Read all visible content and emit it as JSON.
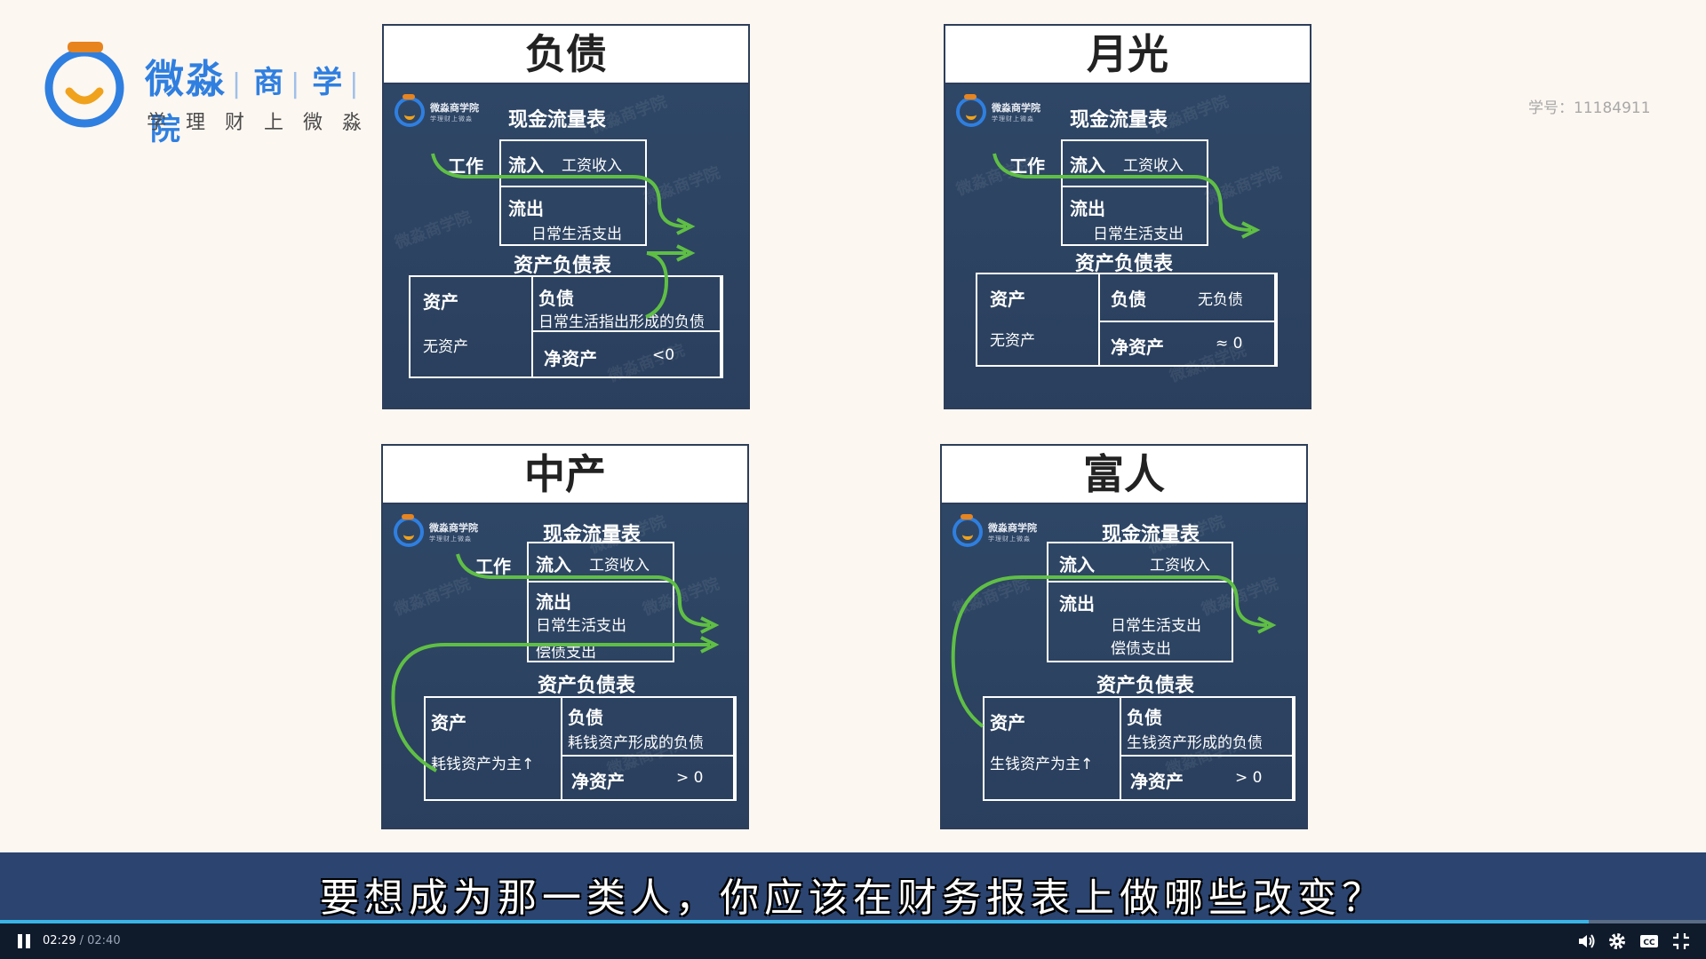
{
  "brand": {
    "name": "微淼",
    "sub": "商",
    "sub2": "学",
    "sub3": "院",
    "slogan": "学理财上微淼"
  },
  "student_id": "学号：11184911",
  "cards": {
    "debt": {
      "title": "负债",
      "cashflow_title": "现金流量表",
      "work": "工作",
      "inflow": "流入",
      "inflow_value": "工资收入",
      "outflow": "流出",
      "outflow_value": "日常生活支出",
      "balance_title": "资产负债表",
      "assets": "资产",
      "assets_value": "无资产",
      "liabilities": "负债",
      "liabilities_value": "日常生活指出形成的负债",
      "net": "净资产",
      "net_value": "<0"
    },
    "paycheck": {
      "title": "月光",
      "cashflow_title": "现金流量表",
      "work": "工作",
      "inflow": "流入",
      "inflow_value": "工资收入",
      "outflow": "流出",
      "outflow_value": "日常生活支出",
      "balance_title": "资产负债表",
      "assets": "资产",
      "assets_value": "无资产",
      "liabilities": "负债",
      "liabilities_value": "无负债",
      "net": "净资产",
      "net_value": "≈ 0"
    },
    "middle": {
      "title": "中产",
      "cashflow_title": "现金流量表",
      "work": "工作",
      "inflow": "流入",
      "inflow_value": "工资收入",
      "outflow": "流出",
      "outflow_value": "日常生活支出",
      "outflow_value2": "偿债支出",
      "balance_title": "资产负债表",
      "assets": "资产",
      "assets_value": "耗钱资产为主↑",
      "liabilities": "负债",
      "liabilities_value": "耗钱资产形成的负债",
      "net": "净资产",
      "net_value": "> 0"
    },
    "rich": {
      "title": "富人",
      "cashflow_title": "现金流量表",
      "inflow": "流入",
      "inflow_value": "工资收入",
      "outflow": "流出",
      "outflow_value": "日常生活支出",
      "outflow_value2": "偿债支出",
      "balance_title": "资产负债表",
      "assets": "资产",
      "assets_value": "生钱资产为主↑",
      "liabilities": "负债",
      "liabilities_value": "生钱资产形成的负债",
      "net": "净资产",
      "net_value": "> 0"
    }
  },
  "watermark": "微淼商学院",
  "mini_brand": "微淼商学院",
  "subtitle": "要想成为那一类人，你应该在财务报表上做哪些改变？",
  "player": {
    "current_time": "02:29",
    "separator": " / ",
    "duration": "02:40",
    "progress": 0.931,
    "accent": "#39b4e6"
  }
}
